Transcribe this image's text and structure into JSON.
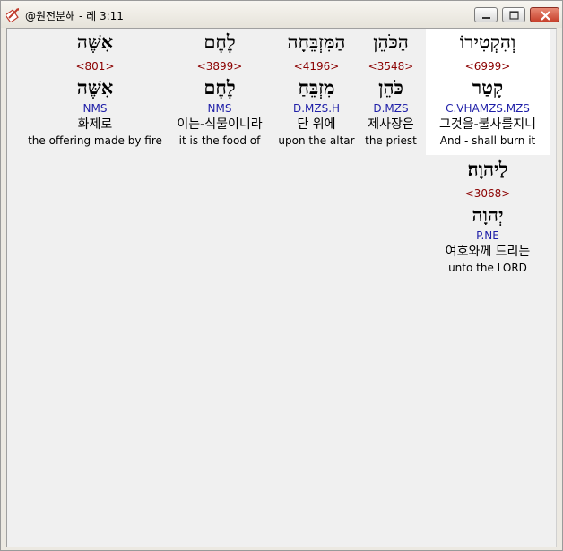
{
  "window": {
    "title": "@원전분해 - 레 3:11",
    "controls": [
      "minimize-icon",
      "maximize-icon",
      "close-icon"
    ]
  },
  "words": [
    {
      "hebrew": "וְהִקְטִירוֹ",
      "strongs": "<6999>",
      "root": "קָטַר",
      "parsing": "C.VHAMZS.MZS",
      "korean": "그것을-불사를지니",
      "english": "And - shall burn it",
      "selected": true
    },
    {
      "hebrew": "הַכֹּהֵן",
      "strongs": "<3548>",
      "root": "כֹּהֵן",
      "parsing": "D.MZS",
      "korean": "제사장은",
      "english": "the priest",
      "selected": false
    },
    {
      "hebrew": "הַמִּזְבֵּחָה",
      "strongs": "<4196>",
      "root": "מִזְבֵּחַ",
      "parsing": "D.MZS.H",
      "korean": "단 위에",
      "english": "upon the altar",
      "selected": false
    },
    {
      "hebrew": "לֶחֶם",
      "strongs": "<3899>",
      "root": "לֶחֶם",
      "parsing": "NMS",
      "korean": "이는-식물이니라",
      "english": "it is the food of",
      "selected": false
    },
    {
      "hebrew": "אִשֶּׁה",
      "strongs": "<801>",
      "root": "אִשֶּׁה",
      "parsing": "NMS",
      "korean": "화제로",
      "english": "the offering made by fire",
      "selected": false
    },
    {
      "hebrew": "לַיהוָה׃",
      "strongs": "<3068>",
      "root": "יְהוָה",
      "parsing": "P.NE",
      "korean": "여호와께 드리는",
      "english": "unto the LORD",
      "selected": false
    }
  ]
}
